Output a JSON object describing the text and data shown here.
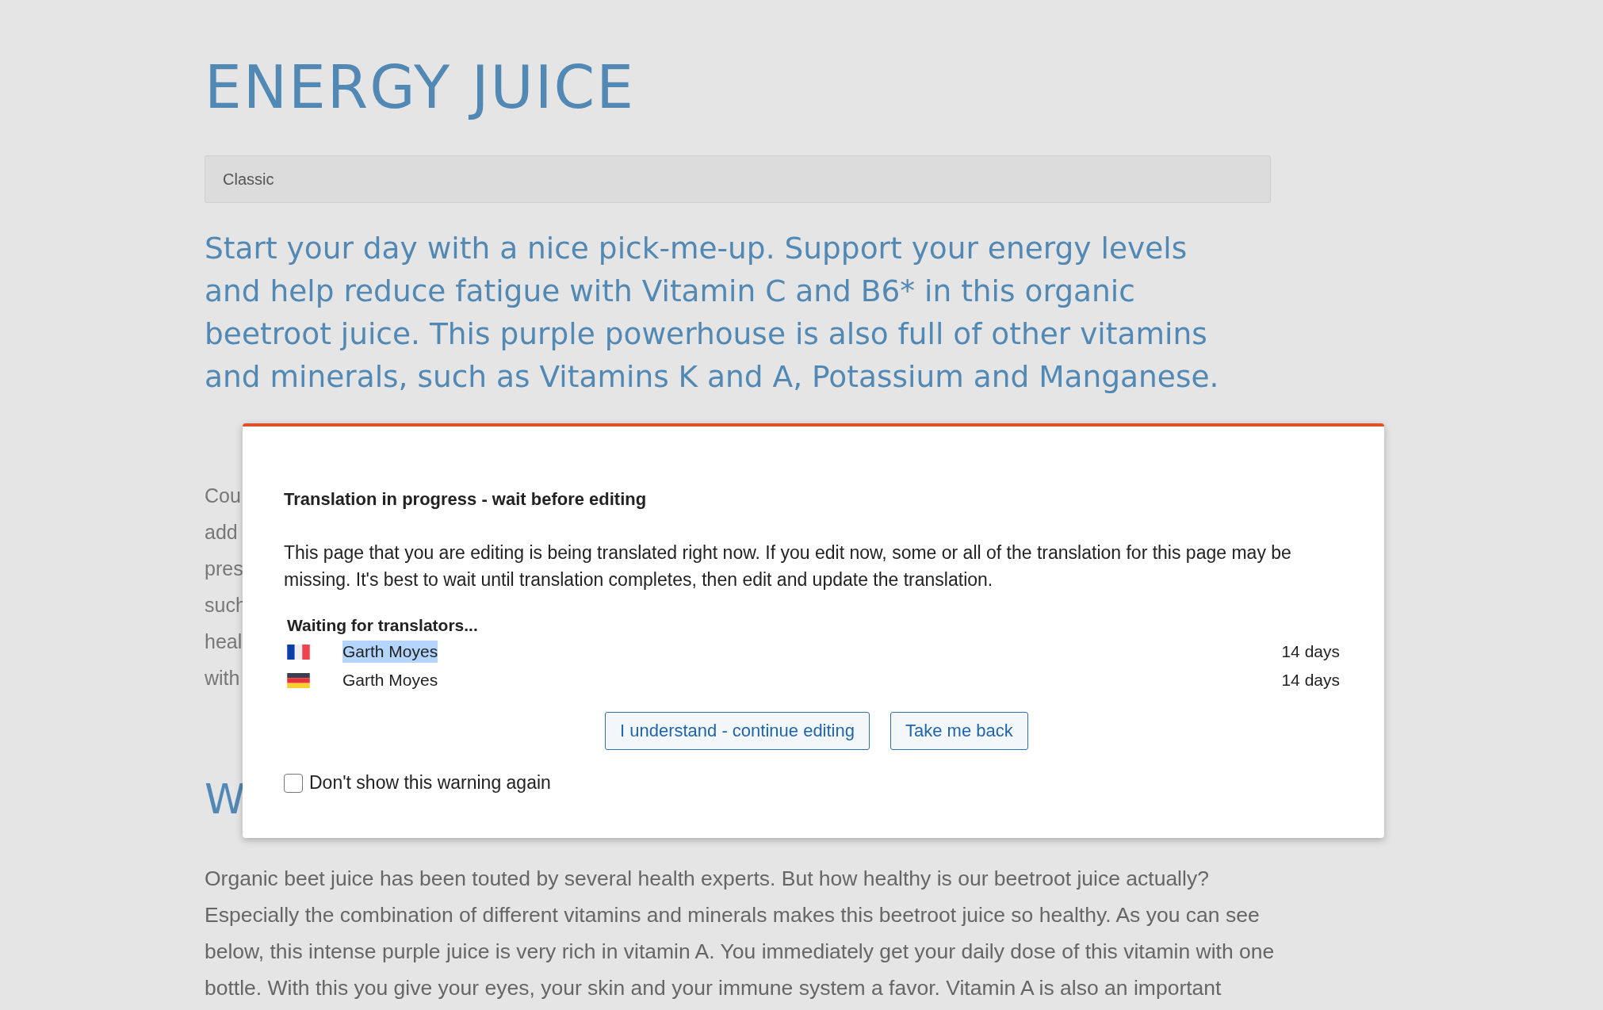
{
  "page": {
    "title": "ENERGY JUICE",
    "variant_bar": {
      "value": "Classic"
    },
    "intro": [
      "Start your day with a nice pick-me-up. Support your energy levels",
      "and help reduce fatigue with Vitamin C and B6* in this organic",
      "beetroot juice. This purple powerhouse is also full of other vitamins",
      "and minerals, such as Vitamins K and A, Potassium and Manganese."
    ],
    "covered_lines": [
      "Cou",
      "add",
      "pres",
      "such",
      "heal",
      "with"
    ],
    "heading": "W",
    "body": [
      "Organic beet juice has been touted by several health experts. But how healthy is our beetroot juice actually?",
      "Especially the combination of different vitamins and minerals makes this beetroot juice so healthy. As you can see",
      "below, this intense purple juice is very rich in vitamin A. You immediately get your daily dose of this vitamin with one",
      "bottle. With this you give your eyes, your skin and your immune system a favor. Vitamin A is also an important"
    ]
  },
  "dialog": {
    "title": "Translation in progress - wait before editing",
    "message": "This page that you are editing is being translated right now. If you edit now, some or all of the translation for this page may be missing. It's best to wait until translation completes, then edit and update the translation.",
    "waiting_label": "Waiting for translators...",
    "translators": [
      {
        "kind": "french",
        "name": "Garth Moyes",
        "time": "14 days",
        "highlighted": true
      },
      {
        "kind": "german",
        "name": "Garth Moyes",
        "time": "14 days",
        "highlighted": false
      }
    ],
    "buttons": [
      "I understand - continue editing",
      "Take me back"
    ],
    "dont_show_again": {
      "label": "Don't show this warning again",
      "checked": false
    }
  }
}
